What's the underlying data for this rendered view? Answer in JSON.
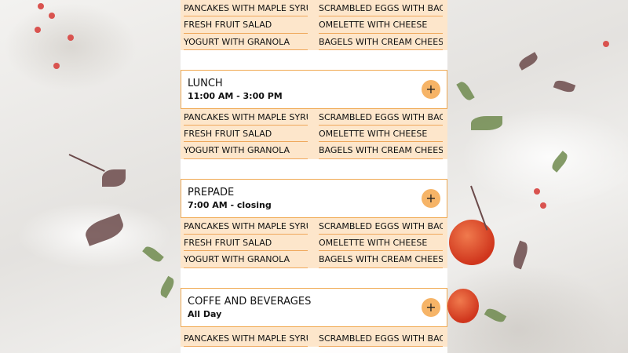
{
  "menu": {
    "top_items": [
      "PANCAKES WITH MAPLE SYRUP",
      "SCRAMBLED EGGS WITH BACON",
      "FRESH FRUIT SALAD",
      "OMELETTE WITH CHEESE",
      "YOGURT WITH GRANOLA",
      "BAGELS WITH CREAM CHEESE"
    ],
    "sections": [
      {
        "title": "LUNCH",
        "hours": "11:00 AM - 3:00 PM",
        "toggle_label": "+",
        "items": [
          "PANCAKES WITH MAPLE SYRUP",
          "SCRAMBLED EGGS WITH BACON",
          "FRESH FRUIT SALAD",
          "OMELETTE WITH CHEESE",
          "YOGURT WITH GRANOLA",
          "BAGELS WITH CREAM CHEESE"
        ]
      },
      {
        "title": "PREPADE",
        "hours": "7:00 AM - closing",
        "toggle_label": "+",
        "items": [
          "PANCAKES WITH MAPLE SYRUP",
          "SCRAMBLED EGGS WITH BACON",
          "FRESH FRUIT SALAD",
          "OMELETTE WITH CHEESE",
          "YOGURT WITH GRANOLA",
          "BAGELS WITH CREAM CHEESE"
        ]
      },
      {
        "title": "COFFE AND BEVERAGES",
        "hours": "All Day",
        "toggle_label": "+",
        "items": [
          "PANCAKES WITH MAPLE SYRUP",
          "SCRAMBLED EGGS WITH BACON"
        ]
      }
    ]
  },
  "colors": {
    "accent": "#f0a951",
    "toggle_bg": "#f6b467",
    "items_bg": "#fde6cb"
  }
}
